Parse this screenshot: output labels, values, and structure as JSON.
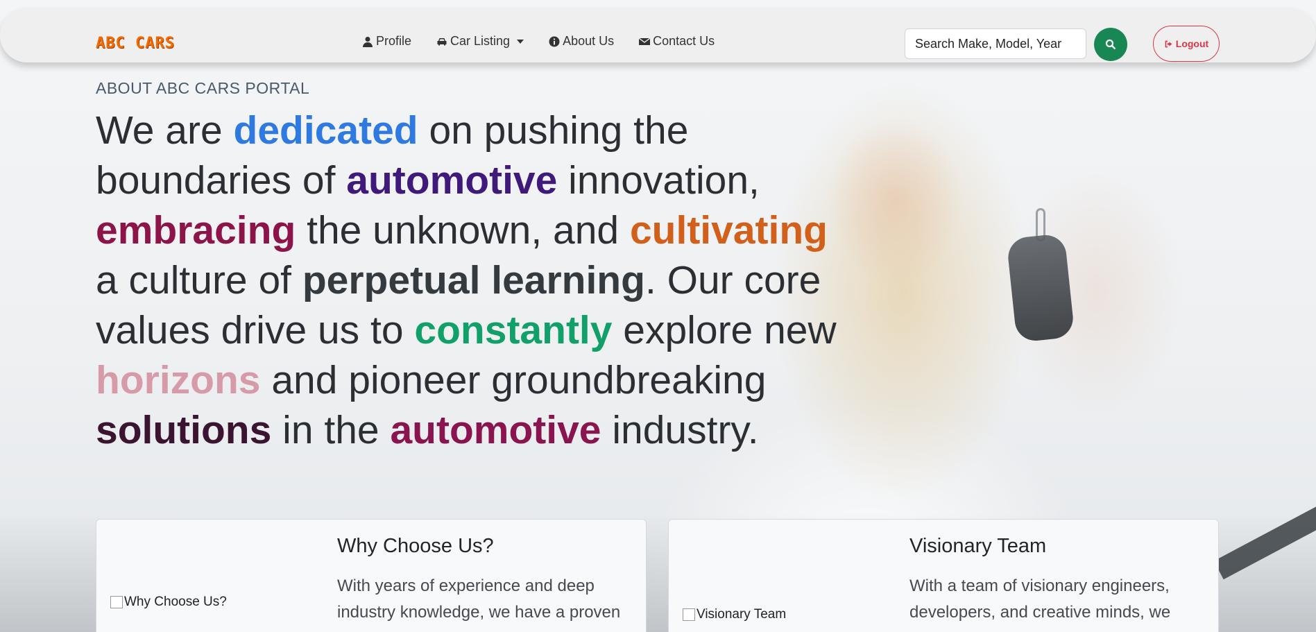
{
  "navbar": {
    "brand": "ABC CARS",
    "links": [
      {
        "label": "Profile",
        "icon": "user-icon"
      },
      {
        "label": "Car Listing",
        "icon": "car-icon",
        "dropdown": true
      },
      {
        "label": "About Us",
        "icon": "info-circle-icon"
      },
      {
        "label": "Contact Us",
        "icon": "envelope-icon"
      }
    ],
    "search": {
      "placeholder": "Search Make, Model, Year"
    },
    "search_button_icon": "search-icon",
    "logout": {
      "label": "Logout",
      "icon": "sign-out-icon"
    }
  },
  "hero": {
    "eyebrow": "ABOUT ABC CARS PORTAL",
    "segments": [
      "We are ",
      "dedicated",
      " on pushing the boundaries of ",
      "automotive",
      " innovation, ",
      "embracing",
      " the unknown, and ",
      "cultivating",
      " a culture of ",
      "perpetual learning",
      ". Our core values drive us to ",
      "constantly",
      " explore new ",
      "horizons",
      " and pioneer groundbreaking ",
      "solutions",
      " in the ",
      "automotive",
      " industry."
    ]
  },
  "cards": [
    {
      "image_alt": "Why Choose Us?",
      "title": "Why Choose Us?",
      "text": "With years of experience and deep industry knowledge, we have a proven"
    },
    {
      "image_alt": "Visionary Team",
      "title": "Visionary Team",
      "text": "With a team of visionary engineers, developers, and creative minds, we"
    }
  ],
  "colors": {
    "brand": "#f26b00",
    "search_button": "#198754",
    "logout": "#dc3545",
    "highlight_blue": "#2f7ae0",
    "highlight_purple": "#3f1a7a",
    "highlight_crimson": "#8c1448",
    "highlight_orange": "#d2601b",
    "highlight_green": "#12a06a",
    "highlight_pink": "#d79aa9"
  }
}
